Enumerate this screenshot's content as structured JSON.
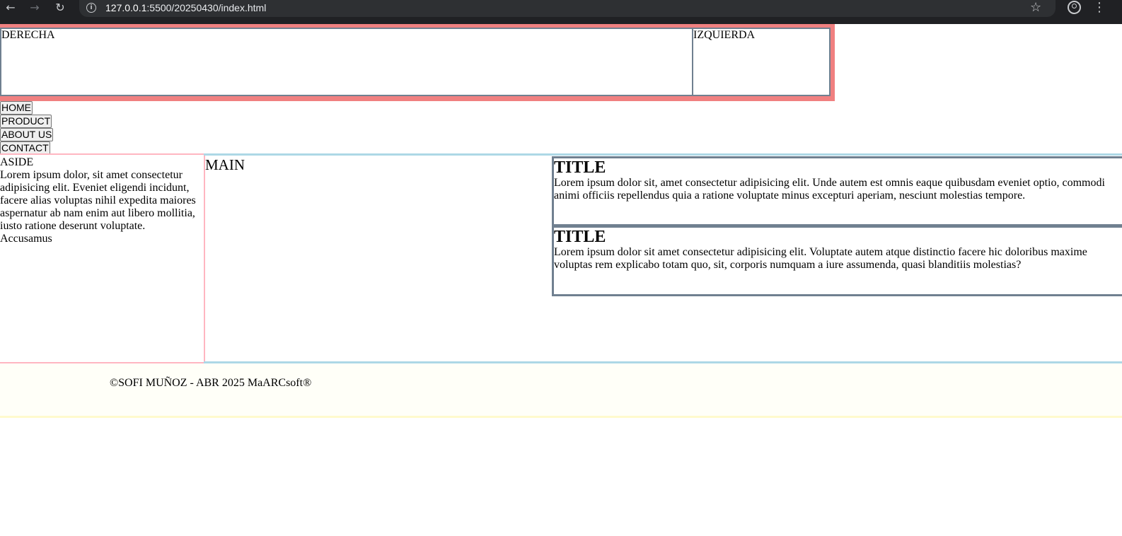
{
  "browser": {
    "url_host": "127.0.0.1",
    "url_rest": ":5500/20250430/index.html"
  },
  "header": {
    "derecha": "DERECHA",
    "izquierda": "IZQUIERDA"
  },
  "nav": {
    "home": "HOME",
    "product": "PRODUCT",
    "about": "ABOUT US",
    "contact": "CONTACT"
  },
  "aside": {
    "label": "ASIDE",
    "text": "Lorem ipsum dolor, sit amet consectetur adipisicing elit. Eveniet eligendi incidunt, facere alias voluptas nihil expedita maiores aspernatur ab nam enim aut libero mollitia, iusto ratione deserunt voluptate. Accusamus"
  },
  "main": {
    "label": "MAIN",
    "articles": [
      {
        "title": "TITLE",
        "text": "Lorem ipsum dolor sit, amet consectetur adipisicing elit. Unde autem est omnis eaque quibusdam eveniet optio, commodi animi officiis repellendus quia a ratione voluptate minus excepturi aperiam, nesciunt molestias tempore."
      },
      {
        "title": "TITLE",
        "text": "Lorem ipsum dolor sit amet consectetur adipisicing elit. Voluptate autem atque distinctio facere hic doloribus maxime voluptas rem explicabo totam quo, sit, corporis numquam a iure assumenda, quasi blanditiis molestias?"
      }
    ]
  },
  "footer": {
    "text": "©SOFI MUÑOZ - ABR 2025 MaARCsoft®"
  },
  "colors": {
    "header_bg": "#f08080",
    "box_border": "#708090",
    "aside_border": "#ffb6c1",
    "main_border": "#add8e6",
    "footer_border": "#fffacd"
  }
}
